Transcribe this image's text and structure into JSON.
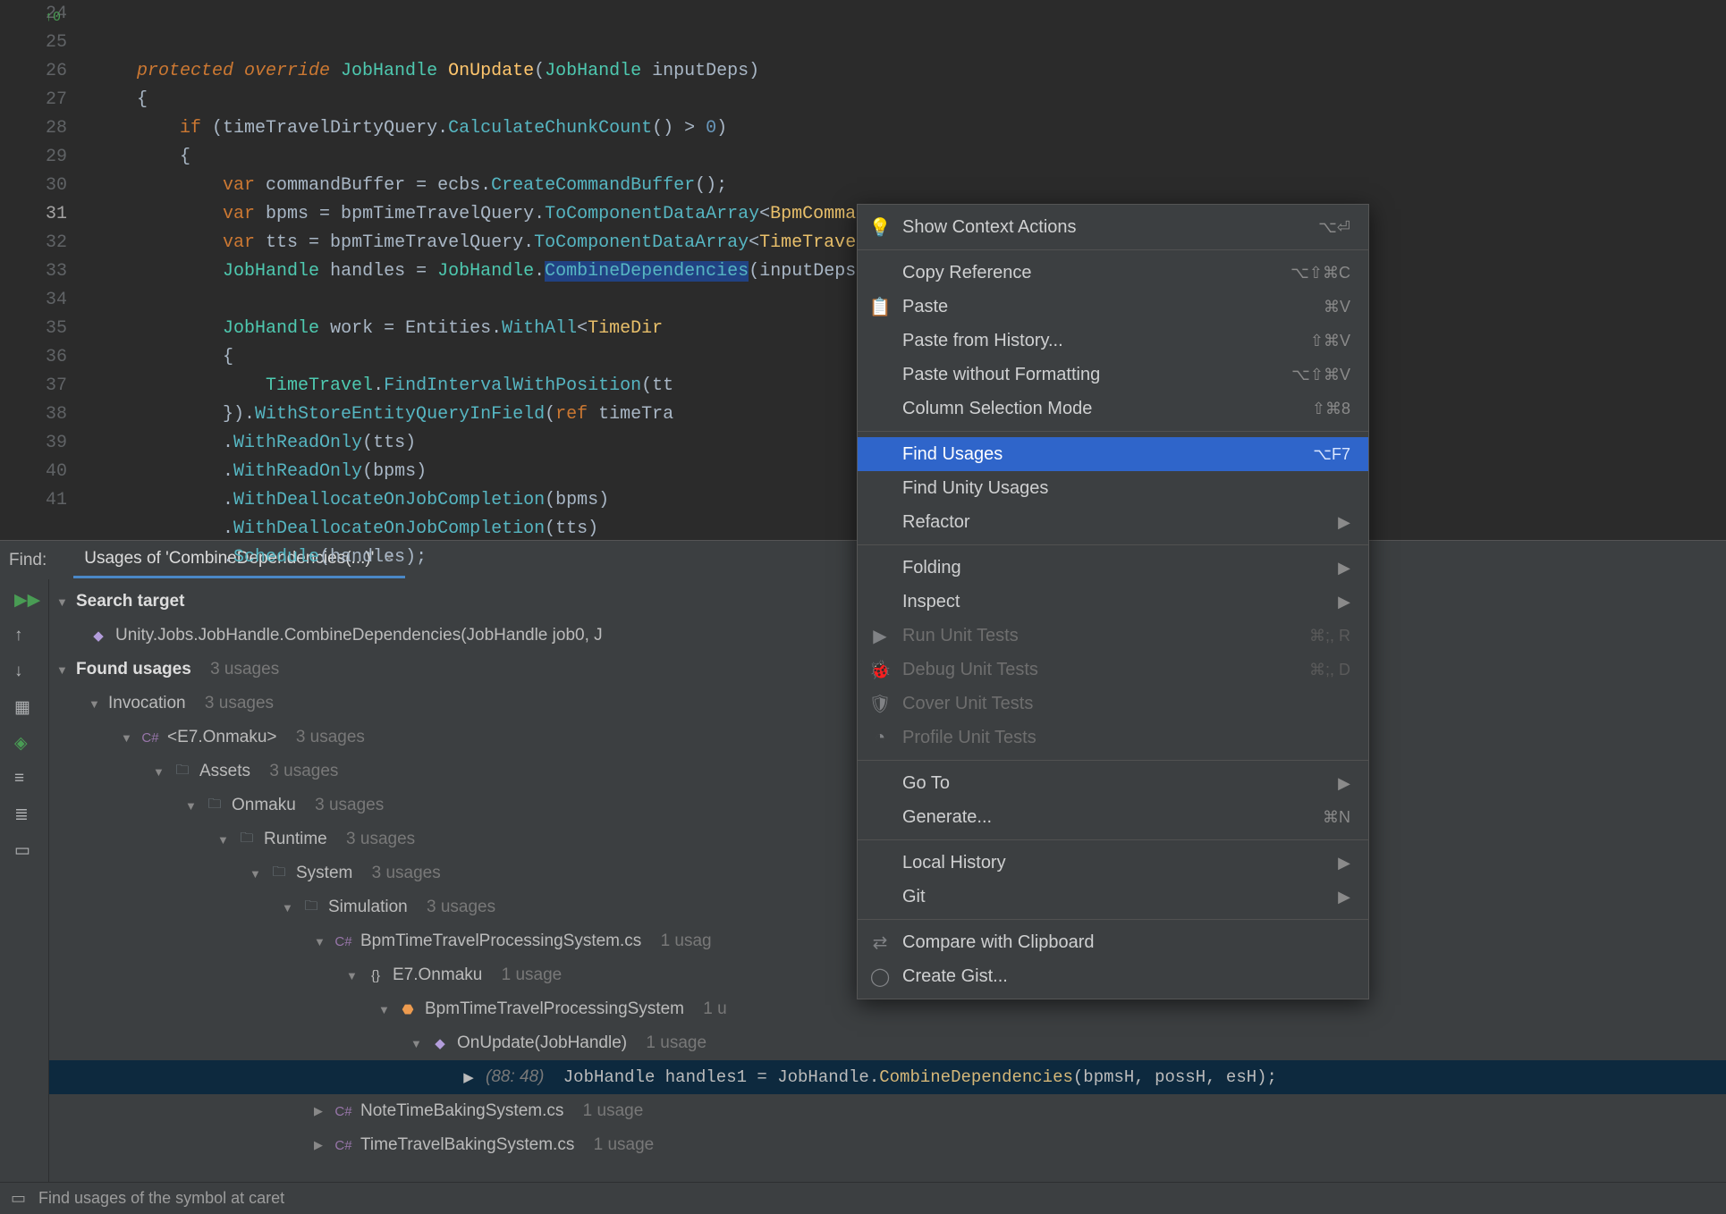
{
  "editor": {
    "line_start": 24,
    "active_line": 31,
    "gutter_marker": "↑0",
    "lines": {
      "l24": "        protected override JobHandle OnUpdate(JobHandle inputDeps)",
      "l25": "        {",
      "l26": "            if (timeTravelDirtyQuery.CalculateChunkCount() > 0)",
      "l27": "            {",
      "l28": "                var commandBuffer = ecbs.CreateCommandBuffer();",
      "l29": "                var bpms = bpmTimeTravelQuery.ToComponentDataArray<BpmCommand>(Allocator.TempJob, out var bpmH);",
      "l30": "                var tts = bpmTimeTravelQuery.ToComponentDataArray<TimeTravel>(Allocator.TempJob, out var ttH);",
      "l31": "                JobHandle handles = JobHandle.CombineDependencies(inputDeps, bpmH, ttH);",
      "l32": "",
      "l33": "                JobHandle work = Entities.WithAll<TimeDir                                    sition np) =>",
      "l34": "                {",
      "l35": "                    TimeTravel.FindIntervalWithPosition(tt                                    dex);",
      "l36": "                }).WithStoreEntityQueryInField(ref timeTra",
      "l37": "                .WithReadOnly(tts)",
      "l38": "                .WithReadOnly(bpms)",
      "l39": "                .WithDeallocateOnJobCompletion(bpms)",
      "l40": "                .WithDeallocateOnJobCompletion(tts)",
      "l41": "                .Schedule(handles);"
    }
  },
  "find": {
    "label": "Find:",
    "tab": "Usages of 'CombineDependencies(...)'"
  },
  "tree": {
    "search_target_header": "Search target",
    "search_target": "Unity.Jobs.JobHandle.CombineDependencies(JobHandle job0, J",
    "found_header": "Found usages",
    "found_count": "3 usages",
    "invocation": "Invocation",
    "invocation_count": "3 usages",
    "project": "<E7.Onmaku>",
    "project_count": "3 usages",
    "assets": "Assets",
    "assets_count": "3 usages",
    "onmaku": "Onmaku",
    "onmaku_count": "3 usages",
    "runtime": "Runtime",
    "runtime_count": "3 usages",
    "system": "System",
    "system_count": "3 usages",
    "simulation": "Simulation",
    "simulation_count": "3 usages",
    "file1": "BpmTimeTravelProcessingSystem.cs",
    "file1_count": "1 usag",
    "ns": "E7.Onmaku",
    "ns_count": "1 usage",
    "class1": "BpmTimeTravelProcessingSystem",
    "class1_count": "1 u",
    "method1": "OnUpdate(JobHandle)",
    "method1_count": "1 usage",
    "hit_loc": "(88: 48)",
    "hit_code_pre": "JobHandle handles1 = ",
    "hit_code_mid": "JobHandle.",
    "hit_code_bold": "CombineDependencies",
    "hit_code_post": "(bpmsH, possH, esH);",
    "file2": "NoteTimeBakingSystem.cs",
    "file2_count": "1 usage",
    "file3": "TimeTravelBakingSystem.cs",
    "file3_count": "1 usage"
  },
  "status": {
    "text": "Find usages of the symbol at caret"
  },
  "menu": {
    "show_context": "Show Context Actions",
    "show_context_sc": "⌥⏎",
    "copy_ref": "Copy Reference",
    "copy_ref_sc": "⌥⇧⌘C",
    "paste": "Paste",
    "paste_sc": "⌘V",
    "paste_hist": "Paste from History...",
    "paste_hist_sc": "⇧⌘V",
    "paste_plain": "Paste without Formatting",
    "paste_plain_sc": "⌥⇧⌘V",
    "col_sel": "Column Selection Mode",
    "col_sel_sc": "⇧⌘8",
    "find_usages": "Find Usages",
    "find_usages_sc": "⌥F7",
    "find_unity": "Find Unity Usages",
    "refactor": "Refactor",
    "folding": "Folding",
    "inspect": "Inspect",
    "run_tests": "Run Unit Tests",
    "run_tests_sc": "⌘;, R",
    "debug_tests": "Debug Unit Tests",
    "debug_tests_sc": "⌘;, D",
    "cover_tests": "Cover Unit Tests",
    "profile_tests": "Profile Unit Tests",
    "goto": "Go To",
    "generate": "Generate...",
    "generate_sc": "⌘N",
    "local_hist": "Local History",
    "git": "Git",
    "compare_clip": "Compare with Clipboard",
    "create_gist": "Create Gist..."
  }
}
